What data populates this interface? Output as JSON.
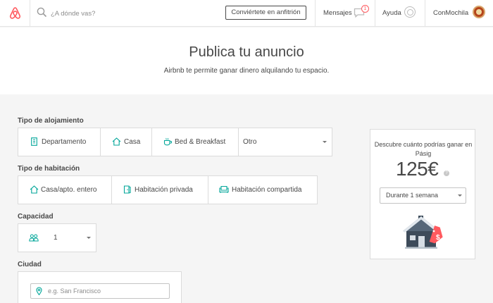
{
  "header": {
    "search_placeholder": "¿A dónde vas?",
    "host_button": "Conviértete en anfitrión",
    "messages_label": "Mensajes",
    "messages_count": "1",
    "help_label": "Ayuda",
    "user_name": "ConMochila"
  },
  "hero": {
    "title": "Publica tu anuncio",
    "subtitle": "Airbnb te permite ganar dinero alquilando tu espacio."
  },
  "form": {
    "accommodation_type": {
      "label": "Tipo de alojamiento",
      "options": [
        "Departamento",
        "Casa",
        "Bed & Breakfast"
      ],
      "other_select": "Otro"
    },
    "room_type": {
      "label": "Tipo de habitación",
      "options": [
        "Casa/apto. entero",
        "Habitación privada",
        "Habitación compartida"
      ]
    },
    "capacity": {
      "label": "Capacidad",
      "value": "1"
    },
    "city": {
      "label": "Ciudad",
      "placeholder": "e.g. San Francisco"
    }
  },
  "estimate": {
    "text": "Descubre cuánto podrías ganar en Pásig",
    "price": "125€",
    "period_select": "Durante 1 semana",
    "house_badge": "$"
  },
  "colors": {
    "brand": "#ff5a5f",
    "accent_teal": "#00a699",
    "text": "#484848"
  }
}
